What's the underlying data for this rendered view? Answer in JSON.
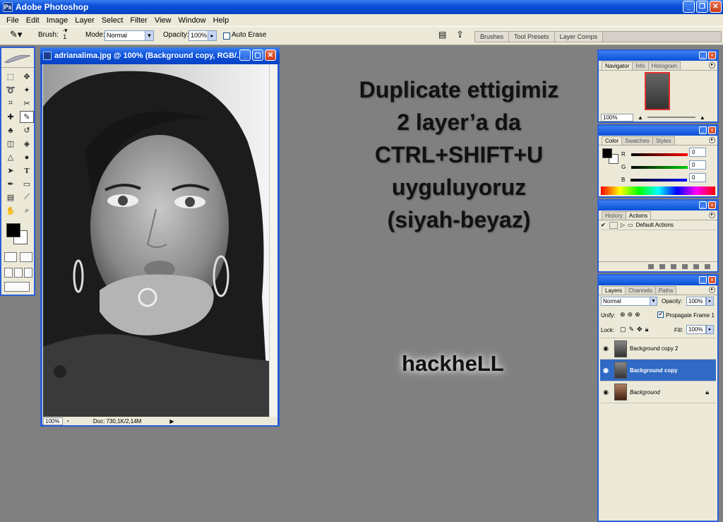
{
  "app": {
    "title": "Adobe Photoshop"
  },
  "menu": [
    "File",
    "Edit",
    "Image",
    "Layer",
    "Select",
    "Filter",
    "View",
    "Window",
    "Help"
  ],
  "options_bar": {
    "brush_label": "Brush:",
    "brush_size": "1",
    "mode_label": "Mode:",
    "mode_value": "Normal",
    "opacity_label": "Opacity:",
    "opacity_value": "100%",
    "auto_erase_label": "Auto Erase",
    "palette_wells": [
      "Brushes",
      "Tool Presets",
      "Layer Comps"
    ]
  },
  "document": {
    "title": "adrianalima.jpg @ 100% (Background copy, RGB/...",
    "zoom": "100%",
    "doc_size": "Doc: 730,1K/2,14M"
  },
  "overlay": {
    "lines": [
      "Duplicate ettigimiz",
      "2 layer’a da",
      "CTRL+SHIFT+U",
      "uyguluyoruz",
      "(siyah-beyaz)"
    ],
    "signature": "hackheLL"
  },
  "navigator": {
    "tabs": [
      "Navigator",
      "Info",
      "Histogram"
    ],
    "zoom": "100%"
  },
  "color": {
    "tabs": [
      "Color",
      "Swatches",
      "Styles"
    ],
    "r_label": "R",
    "g_label": "G",
    "b_label": "B",
    "r": "0",
    "g": "0",
    "b": "0"
  },
  "actions": {
    "tabs": [
      "History",
      "Actions"
    ],
    "items": [
      "Default Actions"
    ]
  },
  "layers": {
    "tabs": [
      "Layers",
      "Channels",
      "Paths"
    ],
    "blend_mode": "Normal",
    "opacity_label": "Opacity:",
    "opacity": "100%",
    "unify_label": "Unify:",
    "propagate_label": "Propagate Frame 1",
    "lock_label": "Lock:",
    "fill_label": "Fill:",
    "fill": "100%",
    "rows": [
      {
        "name": "Background copy 2",
        "selected": false
      },
      {
        "name": "Background copy",
        "selected": true
      },
      {
        "name": "Background",
        "selected": false
      }
    ]
  }
}
